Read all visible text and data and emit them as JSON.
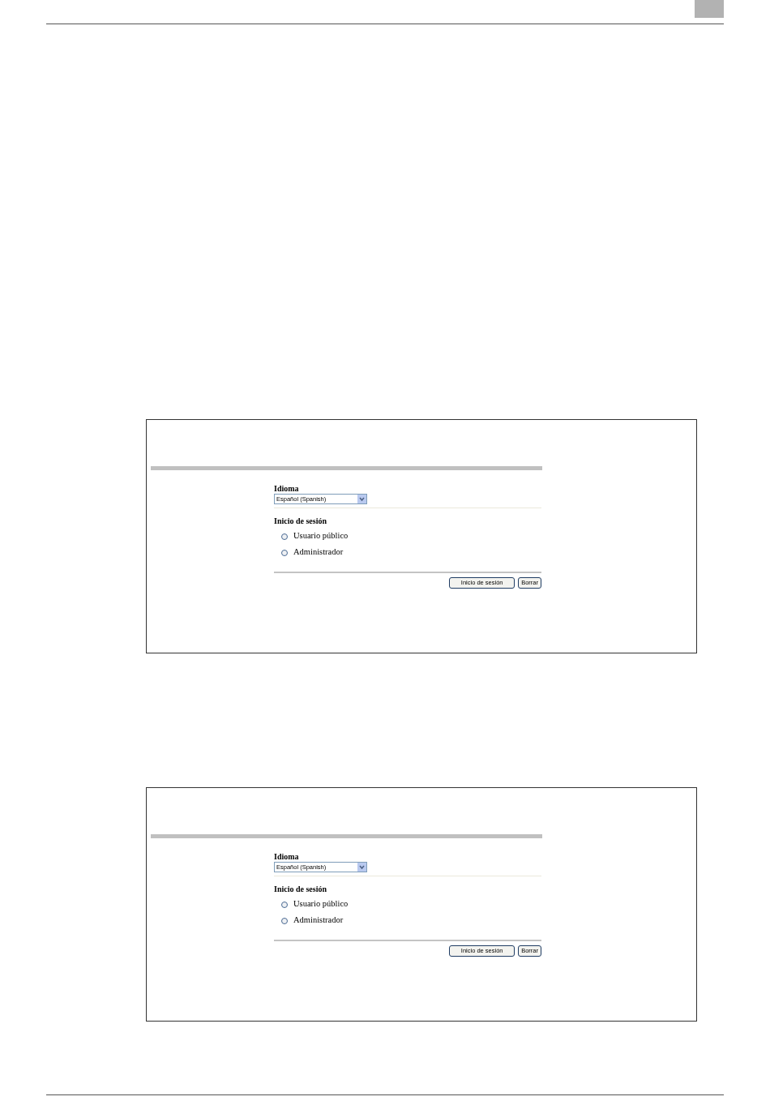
{
  "screens": [
    {
      "language": {
        "label": "Idioma",
        "value": "Español (Spanish)"
      },
      "login": {
        "heading": "Inicio de sesión",
        "options": [
          {
            "label": "Usuario público",
            "selected": false
          },
          {
            "label": "Administrador",
            "selected": false
          }
        ]
      },
      "buttons": [
        "Inicio de sesión",
        "Borrar"
      ]
    },
    {
      "language": {
        "label": "Idioma",
        "value": "Español (Spanish)"
      },
      "login": {
        "heading": "Inicio de sesión",
        "options": [
          {
            "label": "Usuario público",
            "selected": false
          },
          {
            "label": "Administrador",
            "selected": false
          }
        ]
      },
      "buttons": [
        "Inicio de sesión",
        "Borrar"
      ]
    }
  ]
}
